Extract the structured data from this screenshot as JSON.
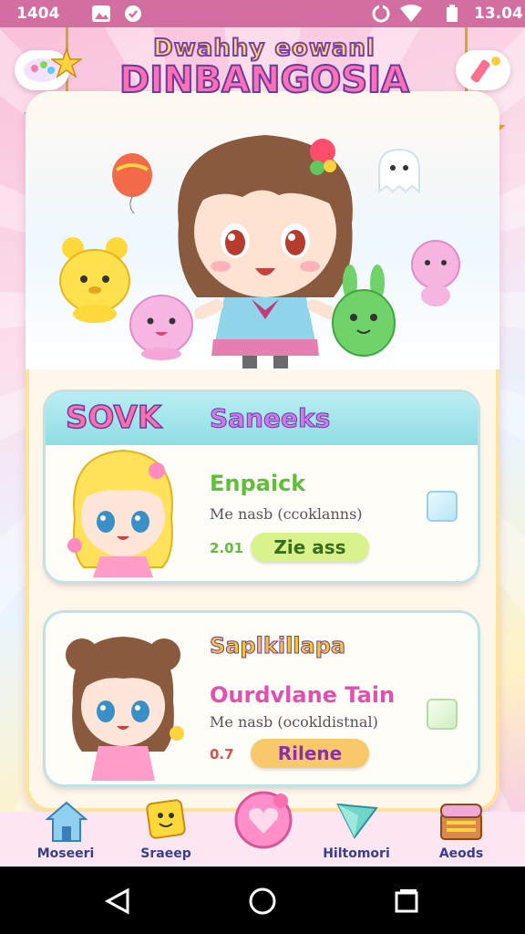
{
  "status_bar": {
    "time_left": "1404",
    "time_right": "13.04"
  },
  "header": {
    "title_line1": "Dwahhy eowanl",
    "title_line2": "DINBANGOSIA"
  },
  "section": {
    "tag": "SOVK",
    "title": "Saneeks"
  },
  "cards": [
    {
      "title": "Enpaick",
      "subtitle": "Me nasb (ccoklanns)",
      "number": "2.01",
      "button": "Zie ass",
      "title_color": "#5fbf3a",
      "button_color": "#d8f38c"
    },
    {
      "title": "Saplkillapa",
      "title2": "Ourdvlane Tain",
      "subtitle": "Me nasb (ocokldistnal)",
      "number": "0.7",
      "button": "Rilene",
      "title_color": "#f2c53d",
      "title2_color": "#e34fb1",
      "button_color": "#f9c86b"
    }
  ],
  "bottom_nav": [
    {
      "label": "Moseeri",
      "icon": "house-icon"
    },
    {
      "label": "Sraeep",
      "icon": "smiley-block-icon"
    },
    {
      "label": "",
      "icon": "heart-orb-icon"
    },
    {
      "label": "Hiltomori",
      "icon": "triangle-gem-icon"
    },
    {
      "label": "Aeods",
      "icon": "treasure-chest-icon"
    }
  ],
  "colors": {
    "accent": "#ff6fa8",
    "status_bar": "#d26fa0",
    "nav_label": "#3a3f8c"
  }
}
